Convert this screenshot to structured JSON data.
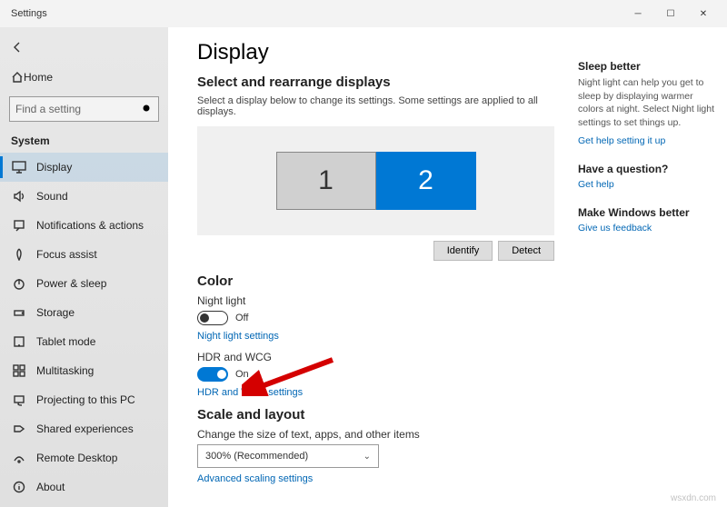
{
  "titlebar": {
    "title": "Settings"
  },
  "sidebar": {
    "back_icon": "back-arrow",
    "home_label": "Home",
    "search_placeholder": "Find a setting",
    "category": "System",
    "items": [
      {
        "label": "Display"
      },
      {
        "label": "Sound"
      },
      {
        "label": "Notifications & actions"
      },
      {
        "label": "Focus assist"
      },
      {
        "label": "Power & sleep"
      },
      {
        "label": "Storage"
      },
      {
        "label": "Tablet mode"
      },
      {
        "label": "Multitasking"
      },
      {
        "label": "Projecting to this PC"
      },
      {
        "label": "Shared experiences"
      },
      {
        "label": "Remote Desktop"
      },
      {
        "label": "About"
      }
    ]
  },
  "main": {
    "page_title": "Display",
    "section_arrange": {
      "heading": "Select and rearrange displays",
      "desc": "Select a display below to change its settings. Some settings are applied to all displays.",
      "monitor1": "1",
      "monitor2": "2",
      "identify": "Identify",
      "detect": "Detect"
    },
    "section_color": {
      "heading": "Color",
      "night_light_label": "Night light",
      "night_light_state": "Off",
      "night_light_settings": "Night light settings",
      "hdr_label": "HDR and WCG",
      "hdr_state": "On",
      "hdr_settings": "HDR and WCG settings"
    },
    "section_scale": {
      "heading": "Scale and layout",
      "change_size_label": "Change the size of text, apps, and other items",
      "scale_value": "300% (Recommended)",
      "advanced": "Advanced scaling settings"
    }
  },
  "right": {
    "sleep_heading": "Sleep better",
    "sleep_text": "Night light can help you get to sleep by displaying warmer colors at night. Select Night light settings to set things up.",
    "sleep_link": "Get help setting it up",
    "question_heading": "Have a question?",
    "question_link": "Get help",
    "better_heading": "Make Windows better",
    "better_link": "Give us feedback"
  },
  "watermark": "wsxdn.com"
}
